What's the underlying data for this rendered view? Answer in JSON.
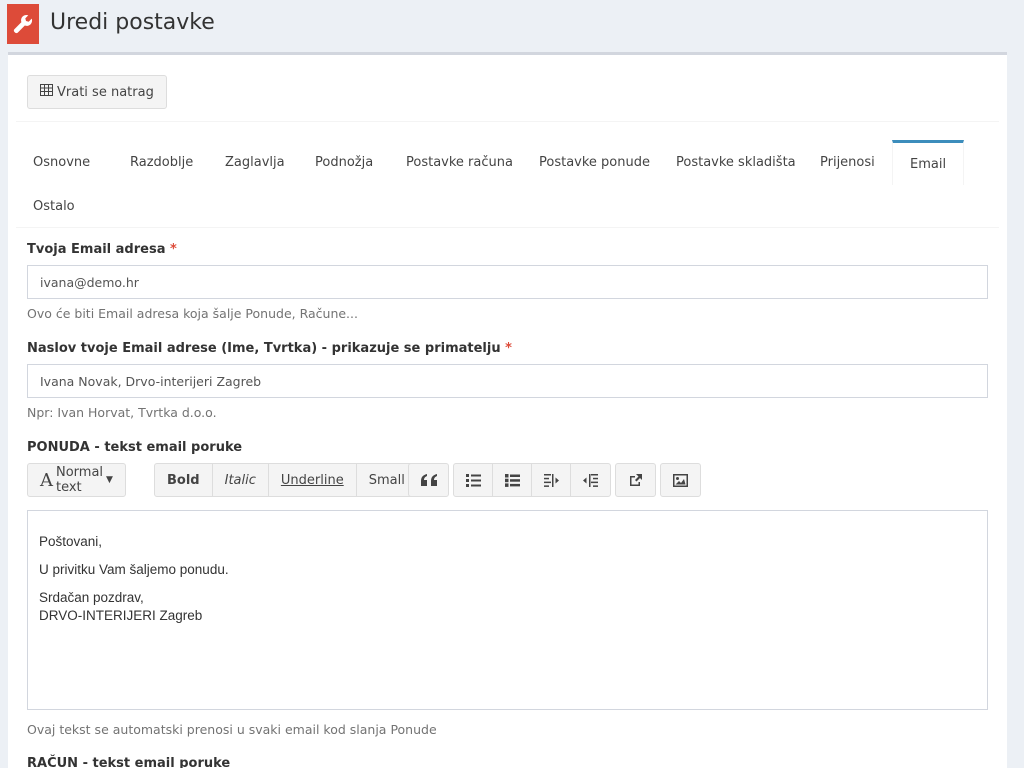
{
  "header": {
    "title": "Uredi postavke",
    "icon": "wrench-icon",
    "icon_color": "#dd4b39"
  },
  "back_button": {
    "label": "Vrati se natrag",
    "icon": "table-icon"
  },
  "tabs": [
    {
      "label": "Osnovne",
      "active": false
    },
    {
      "label": "Razdoblje",
      "active": false
    },
    {
      "label": "Zaglavlja",
      "active": false
    },
    {
      "label": "Podnožja",
      "active": false
    },
    {
      "label": "Postavke računa",
      "active": false
    },
    {
      "label": "Postavke ponude",
      "active": false
    },
    {
      "label": "Postavke skladišta",
      "active": false
    },
    {
      "label": "Prijenosi",
      "active": false
    },
    {
      "label": "Email",
      "active": true
    },
    {
      "label": "Ostalo",
      "active": false
    }
  ],
  "form": {
    "email": {
      "label": "Tvoja Email adresa",
      "required_mark": "*",
      "value": "ivana@demo.hr",
      "help": "Ovo će biti Email adresa koja šalje Ponude, Račune..."
    },
    "sender_name": {
      "label": "Naslov tvoje Email adrese (Ime, Tvrtka) - prikazuje se primatelju",
      "required_mark": "*",
      "value": "Ivana Novak, Drvo-interijeri Zagreb",
      "help": "Npr: Ivan Horvat, Tvrtka d.o.o."
    },
    "offer_text": {
      "label": "PONUDA - tekst email poruke",
      "toolbar": {
        "format_label": "Normal text",
        "bold": "Bold",
        "italic": "Italic",
        "underline": "Underline",
        "small": "Small"
      },
      "body": {
        "line1": "Poštovani,",
        "line2": "U privitku Vam šaljemo ponudu.",
        "line3": "Srdačan pozdrav,",
        "line4": "DRVO-INTERIJERI Zagreb"
      },
      "help": "Ovaj tekst se automatski prenosi u svaki email kod slanja Ponude"
    },
    "invoice_text": {
      "label": "RAČUN - tekst email poruke"
    }
  },
  "colors": {
    "accent": "#3c8dbc",
    "danger": "#dd4b39",
    "background": "#ecf0f5"
  }
}
